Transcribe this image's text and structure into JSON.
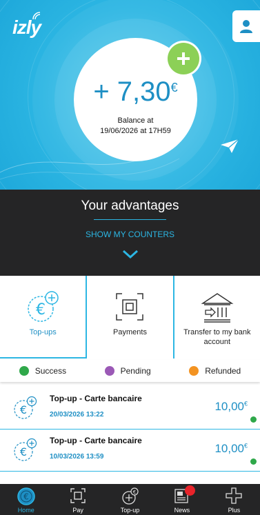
{
  "header": {
    "logo_text": "izly",
    "balance": {
      "sign": "+",
      "amount": "7,30",
      "currency": "€"
    },
    "balance_label_line1": "Balance at",
    "balance_label_line2": "19/06/2026 at 17H59"
  },
  "advantages": {
    "title": "Your advantages",
    "link_label": "SHOW MY COUNTERS"
  },
  "actions": [
    {
      "label": "Top-ups",
      "active": true
    },
    {
      "label": "Payments",
      "active": false
    },
    {
      "label": "Transfer to my bank account",
      "active": false
    }
  ],
  "legend": [
    {
      "label": "Success",
      "color": "#2fa84a"
    },
    {
      "label": "Pending",
      "color": "#9b59b6"
    },
    {
      "label": "Refunded",
      "color": "#f39322"
    }
  ],
  "transactions": [
    {
      "title": "Top-up - Carte bancaire",
      "date": "20/03/2026 13:22",
      "amount": "10,00",
      "currency": "€",
      "status": "success"
    },
    {
      "title": "Top-up - Carte bancaire",
      "date": "10/03/2026 13:59",
      "amount": "10,00",
      "currency": "€",
      "status": "success"
    }
  ],
  "nav": [
    {
      "label": "Home",
      "icon": "euro-circle-icon",
      "active": true
    },
    {
      "label": "Pay",
      "icon": "scan-icon",
      "active": false
    },
    {
      "label": "Top-up",
      "icon": "wallet-plus-icon",
      "active": false
    },
    {
      "label": "News",
      "icon": "newspaper-icon",
      "active": false
    },
    {
      "label": "Plus",
      "icon": "plus-icon",
      "active": false
    }
  ],
  "colors": {
    "accent": "#2cb6e3",
    "accent_dark": "#1e8fc4",
    "add_green": "#8cd057",
    "dark": "#252526"
  }
}
